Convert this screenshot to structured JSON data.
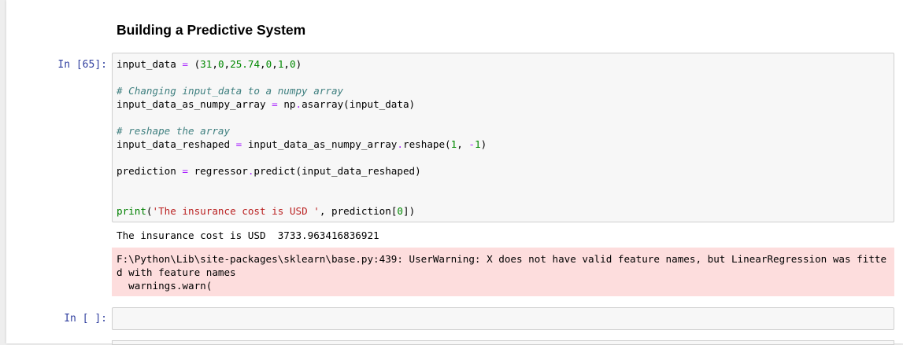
{
  "heading": "Building a Predictive System",
  "cells": [
    {
      "prompt": "In [65]:",
      "code_lines": [
        {
          "kind": "code",
          "tokens": [
            {
              "t": "input_data ",
              "c": ""
            },
            {
              "t": "=",
              "c": "op"
            },
            {
              "t": " (",
              "c": ""
            },
            {
              "t": "31",
              "c": "num"
            },
            {
              "t": ",",
              "c": ""
            },
            {
              "t": "0",
              "c": "num"
            },
            {
              "t": ",",
              "c": ""
            },
            {
              "t": "25.74",
              "c": "num"
            },
            {
              "t": ",",
              "c": ""
            },
            {
              "t": "0",
              "c": "num"
            },
            {
              "t": ",",
              "c": ""
            },
            {
              "t": "1",
              "c": "num"
            },
            {
              "t": ",",
              "c": ""
            },
            {
              "t": "0",
              "c": "num"
            },
            {
              "t": ")",
              "c": ""
            }
          ]
        },
        {
          "kind": "blank"
        },
        {
          "kind": "code",
          "tokens": [
            {
              "t": "# Changing input_data to a numpy array",
              "c": "cm"
            }
          ]
        },
        {
          "kind": "code",
          "tokens": [
            {
              "t": "input_data_as_numpy_array ",
              "c": ""
            },
            {
              "t": "=",
              "c": "op"
            },
            {
              "t": " np",
              "c": ""
            },
            {
              "t": ".",
              "c": "op"
            },
            {
              "t": "asarray(input_data)",
              "c": ""
            }
          ]
        },
        {
          "kind": "blank"
        },
        {
          "kind": "code",
          "tokens": [
            {
              "t": "# reshape the array",
              "c": "cm"
            }
          ]
        },
        {
          "kind": "code",
          "tokens": [
            {
              "t": "input_data_reshaped ",
              "c": ""
            },
            {
              "t": "=",
              "c": "op"
            },
            {
              "t": " input_data_as_numpy_array",
              "c": ""
            },
            {
              "t": ".",
              "c": "op"
            },
            {
              "t": "reshape(",
              "c": ""
            },
            {
              "t": "1",
              "c": "num"
            },
            {
              "t": ", ",
              "c": ""
            },
            {
              "t": "-",
              "c": "op"
            },
            {
              "t": "1",
              "c": "num"
            },
            {
              "t": ")",
              "c": ""
            }
          ]
        },
        {
          "kind": "blank"
        },
        {
          "kind": "code",
          "tokens": [
            {
              "t": "prediction ",
              "c": ""
            },
            {
              "t": "=",
              "c": "op"
            },
            {
              "t": " regressor",
              "c": ""
            },
            {
              "t": ".",
              "c": "op"
            },
            {
              "t": "predict(input_data_reshaped)",
              "c": ""
            }
          ]
        },
        {
          "kind": "blank"
        },
        {
          "kind": "blank"
        },
        {
          "kind": "code",
          "tokens": [
            {
              "t": "print",
              "c": "bi"
            },
            {
              "t": "(",
              "c": ""
            },
            {
              "t": "'The insurance cost is USD '",
              "c": "str"
            },
            {
              "t": ", prediction[",
              "c": ""
            },
            {
              "t": "0",
              "c": "num"
            },
            {
              "t": "])",
              "c": ""
            }
          ]
        }
      ],
      "stdout": "The insurance cost is USD  3733.963416836921",
      "stderr": "F:\\Python\\Lib\\site-packages\\sklearn\\base.py:439: UserWarning: X does not have valid feature names, but LinearRegression was fitted with feature names\n  warnings.warn("
    },
    {
      "prompt": "In [ ]:",
      "code_lines": []
    }
  ],
  "colors": {
    "prompt": "#303F9F",
    "comment": "#408080",
    "number": "#008800",
    "operator": "#aa22ff",
    "string": "#ba2121",
    "builtin": "#008000",
    "stderr_bg": "#fddddd"
  }
}
